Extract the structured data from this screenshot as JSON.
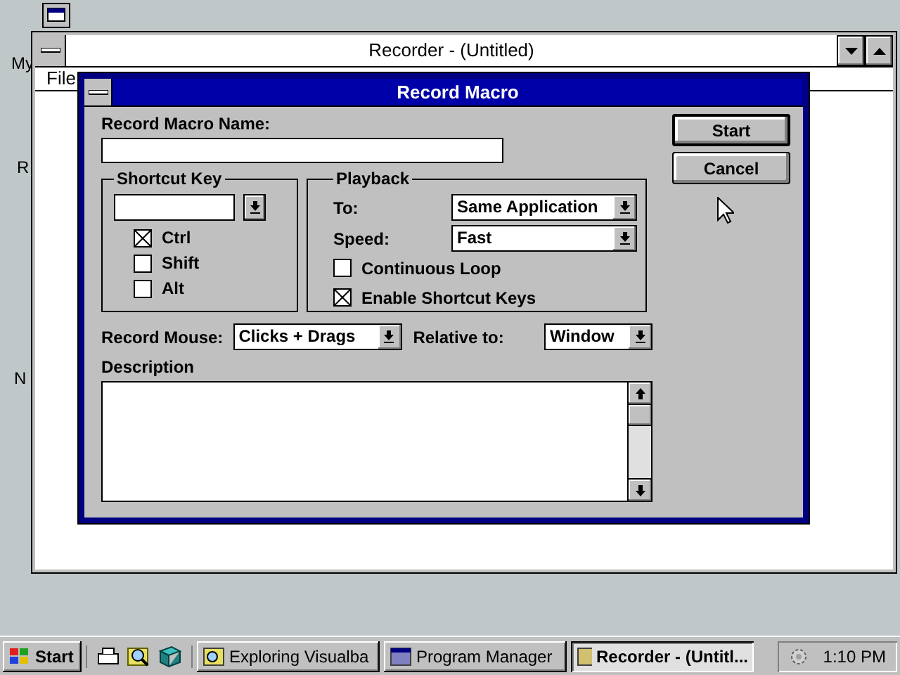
{
  "desktop": {
    "icon_labels": [
      "My",
      "R",
      "N"
    ]
  },
  "recorder_window": {
    "title": "Recorder - (Untitled)",
    "menu": [
      "File"
    ]
  },
  "dialog": {
    "title": "Record Macro",
    "name_label": "Record Macro Name:",
    "shortcut_key": {
      "label": "Shortcut Key",
      "modifiers": [
        {
          "label": "Ctrl",
          "checked": true
        },
        {
          "label": "Shift",
          "checked": false
        },
        {
          "label": "Alt",
          "checked": false
        }
      ]
    },
    "playback": {
      "label": "Playback",
      "to_label": "To:",
      "to_value": "Same Application",
      "speed_label": "Speed:",
      "speed_value": "Fast",
      "options": [
        {
          "label": "Continuous Loop",
          "checked": false
        },
        {
          "label": "Enable Shortcut Keys",
          "checked": true
        }
      ]
    },
    "record_mouse_label": "Record Mouse:",
    "record_mouse_value": "Clicks + Drags",
    "relative_label": "Relative to:",
    "relative_value": "Window",
    "description_label": "Description",
    "buttons": [
      "Start",
      "Cancel"
    ]
  },
  "taskbar": {
    "start": "Start",
    "tasks": [
      {
        "label": "Exploring Visualba",
        "selected": false
      },
      {
        "label": "Program Manager",
        "selected": false
      },
      {
        "label": "Recorder - (Untitl...",
        "selected": true
      }
    ],
    "clock": "1:10 PM"
  }
}
